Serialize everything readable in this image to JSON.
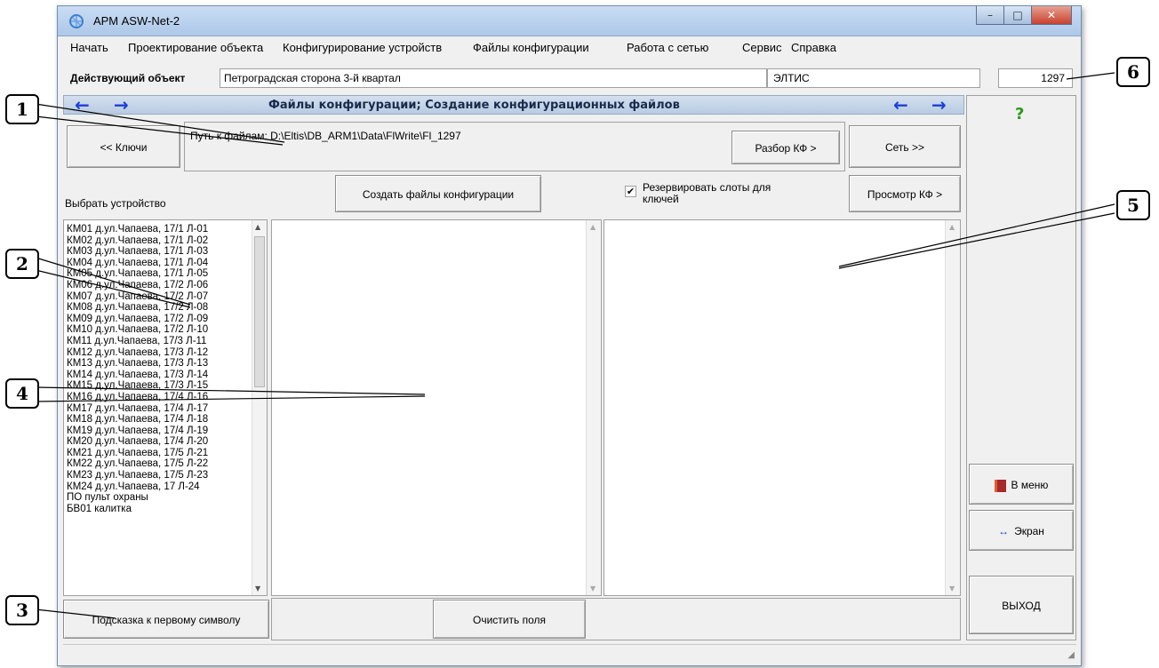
{
  "app": {
    "title": "АРМ ASW-Net-2"
  },
  "window_controls": {
    "minimize": "–",
    "maximize": "□",
    "close": "✕"
  },
  "menu": [
    "Начать",
    "Проектирование объекта",
    "Конфигурирование устройств",
    "Файлы конфигурации",
    "Работа с сетью",
    "Сервис",
    "Справка"
  ],
  "object_bar": {
    "label": "Действующий объект",
    "object_name": "Петроградская сторона 3-й квартал",
    "org": "ЭЛТИС",
    "code": "1297"
  },
  "section": {
    "title": "Файлы конфигурации; Создание конфигурационных файлов",
    "arrow_back": "←",
    "arrow_fwd": "→"
  },
  "path": {
    "keys_button": "<< Ключи",
    "path_label": "Путь к файлам: D:\\Eltis\\DB_ARM1\\Data\\FlWrite\\Fl_1297",
    "parse_button": "Разбор КФ >",
    "network_button": "Сеть >>"
  },
  "toolbar": {
    "select_device": "Выбрать устройство",
    "create_button": "Создать файлы конфигурации",
    "reserve_checkbox": "Резервировать слоты для ключей",
    "reserve_checked": true,
    "view_button": "Просмотр КФ >"
  },
  "devices": [
    "КМ01 д.ул.Чапаева, 17/1 Л-01",
    "КМ02 д.ул.Чапаева, 17/1 Л-02",
    "КМ03 д.ул.Чапаева, 17/1 Л-03",
    "КМ04 д.ул.Чапаева, 17/1 Л-04",
    "КМ05 д.ул.Чапаева, 17/1 Л-05",
    "КМ06 д.ул.Чапаева, 17/2 Л-06",
    "КМ07 д.ул.Чапаева, 17/2 Л-07",
    "КМ08 д.ул.Чапаева, 17/2 Л-08",
    "КМ09 д.ул.Чапаева, 17/2 Л-09",
    "КМ10 д.ул.Чапаева, 17/2 Л-10",
    "КМ11 д.ул.Чапаева, 17/3 Л-11",
    "КМ12 д.ул.Чапаева, 17/3 Л-12",
    "КМ13 д.ул.Чапаева, 17/3 Л-13",
    "КМ14 д.ул.Чапаева, 17/3 Л-14",
    "КМ15 д.ул.Чапаева, 17/3 Л-15",
    "КМ16 д.ул.Чапаева, 17/4 Л-16",
    "КМ17 д.ул.Чапаева, 17/4 Л-17",
    "КМ18 д.ул.Чапаева, 17/4 Л-18",
    "КМ19 д.ул.Чапаева, 17/4 Л-19",
    "КМ20 д.ул.Чапаева, 17/4 Л-20",
    "КМ21 д.ул.Чапаева, 17/5 Л-21",
    "КМ22 д.ул.Чапаева, 17/5 Л-22",
    "КМ23 д.ул.Чапаева, 17/5 Л-23",
    "КМ24 д.ул.Чапаева, 17 Л-24",
    "ПО  пульт охраны",
    "БВ01 калитка"
  ],
  "bottom": {
    "hint_button": "Подсказка к первому символу",
    "clear_button": "Очистить поля"
  },
  "side": {
    "help": "?",
    "menu_button": "В меню",
    "screen_button": "Экран",
    "exit_button": "ВЫХОД"
  },
  "callouts": [
    "1",
    "2",
    "3",
    "4",
    "5",
    "6"
  ],
  "colors": {
    "arrow": "#1c3fd6",
    "help": "#2c9a1b",
    "close": "#c8422f",
    "titlebar": "#bcd3ef"
  }
}
